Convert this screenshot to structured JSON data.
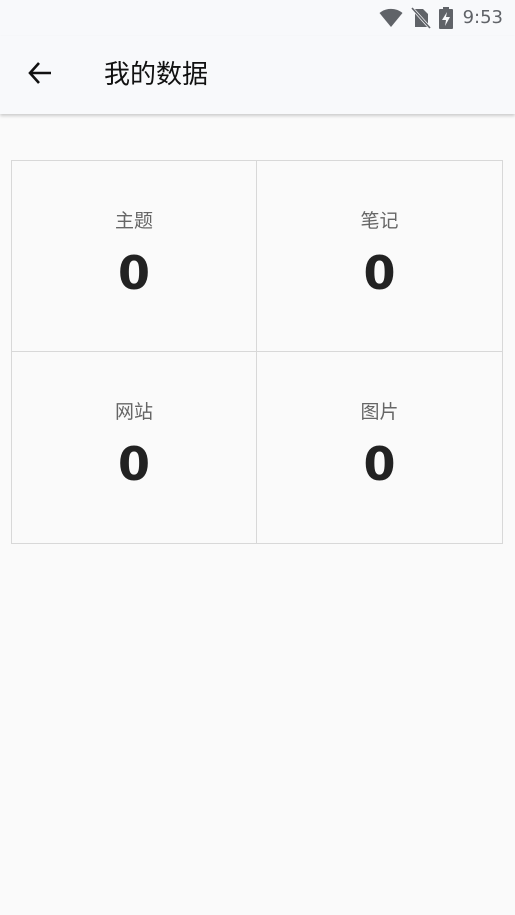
{
  "status_bar": {
    "time": "9:53",
    "icons": [
      "wifi-icon",
      "no-sim-icon",
      "battery-charging-icon"
    ]
  },
  "app_bar": {
    "back_icon": "arrow-left-icon",
    "title": "我的数据"
  },
  "stats": [
    {
      "label": "主题",
      "value": "0"
    },
    {
      "label": "笔记",
      "value": "0"
    },
    {
      "label": "网站",
      "value": "0"
    },
    {
      "label": "图片",
      "value": "0"
    }
  ],
  "colors": {
    "background": "#fafafa",
    "app_bar": "#f8f9fb",
    "border": "#d8d8d8",
    "label": "#666666",
    "value": "#222222"
  }
}
